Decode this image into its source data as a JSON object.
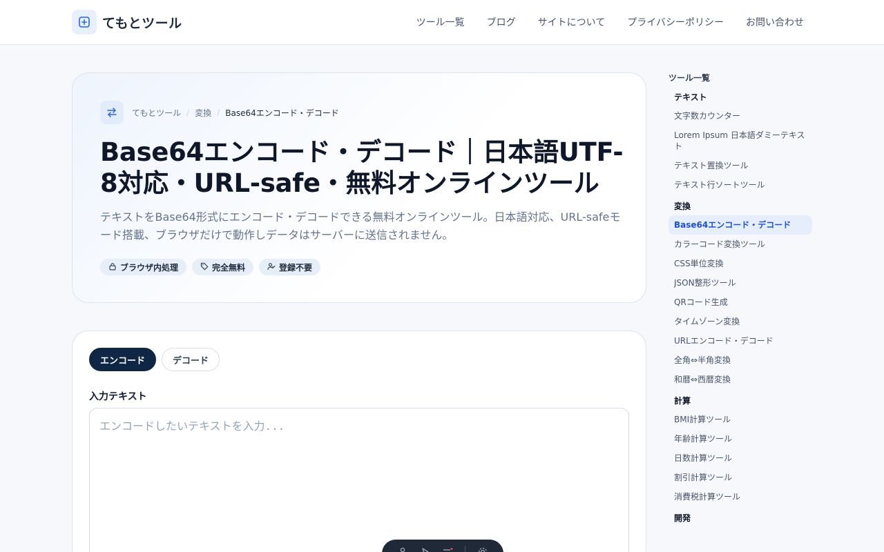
{
  "header": {
    "logo_text": "てもとツール",
    "nav": [
      "ツール一覧",
      "ブログ",
      "サイトについて",
      "プライバシーポリシー",
      "お問い合わせ"
    ]
  },
  "hero": {
    "breadcrumb": [
      "てもとツール",
      "変換",
      "Base64エンコード・デコード"
    ],
    "breadcrumb_separator": "/",
    "title": "Base64エンコード・デコード｜日本語UTF-8対応・URL-safe・無料オンラインツール",
    "description": "テキストをBase64形式にエンコード・デコードできる無料オンラインツール。日本語対応、URL-safeモード搭載、ブラウザだけで動作しデータはサーバーに送信されません。",
    "badges": [
      {
        "icon": "lock-icon",
        "label": "ブラウザ内処理"
      },
      {
        "icon": "tag-icon",
        "label": "完全無料"
      },
      {
        "icon": "user-check-icon",
        "label": "登録不要"
      }
    ]
  },
  "tool": {
    "tabs": [
      "エンコード",
      "デコード"
    ],
    "active_tab": "エンコード",
    "input_label": "入力テキスト",
    "input_placeholder": "エンコードしたいテキストを入力...",
    "input_value": ""
  },
  "sidebar": {
    "title": "ツール一覧",
    "categories": [
      {
        "name": "テキスト",
        "items": [
          "文字数カウンター",
          "Lorem Ipsum 日本語ダミーテキスト",
          "テキスト置換ツール",
          "テキスト行ソートツール"
        ]
      },
      {
        "name": "変換",
        "items": [
          "Base64エンコード・デコード",
          "カラーコード変換ツール",
          "CSS単位変換",
          "JSON整形ツール",
          "QRコード生成",
          "タイムゾーン変換",
          "URLエンコード・デコード",
          "全角⇔半角変換",
          "和暦⇔西暦変換"
        ]
      },
      {
        "name": "計算",
        "items": [
          "BMI計算ツール",
          "年齢計算ツール",
          "日数計算ツール",
          "割引計算ツール",
          "消費税計算ツール"
        ]
      },
      {
        "name": "開発",
        "items": []
      }
    ],
    "active_item": "Base64エンコード・デコード"
  },
  "colors": {
    "accent": "#1d4ed8",
    "primary_dark": "#0f2744",
    "badge_bg": "#e6eef9",
    "page_bg": "#f6f8fb"
  }
}
